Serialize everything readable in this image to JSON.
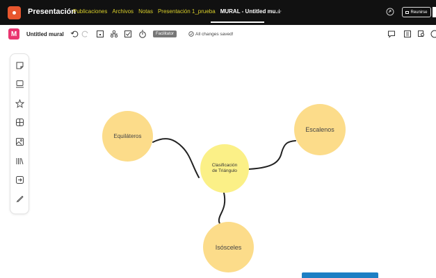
{
  "app": {
    "title": "Presentación",
    "tabs": [
      {
        "label": "Publicaciones"
      },
      {
        "label": "Archivos"
      },
      {
        "label": "Notas"
      },
      {
        "label": "Presentación 1_prueba"
      },
      {
        "label": "MURAL - Untitled mu..."
      }
    ],
    "reunirse_label": "Reunirse"
  },
  "toolbar": {
    "mural_name": "Untitled mural",
    "facilitator_label": "Facilitator",
    "saved_status": "All changes saved!"
  },
  "mural": {
    "center_line1": "Clasificación",
    "center_line2": "de Triángulo",
    "node_equilateros": "Equiláteros",
    "node_escalenos": "Escalenos",
    "node_isosceles": "Isósceles"
  },
  "colors": {
    "center_fill": "#fbf087",
    "node_fill": "#fcdc8a",
    "accent_brand": "#e9356f"
  }
}
